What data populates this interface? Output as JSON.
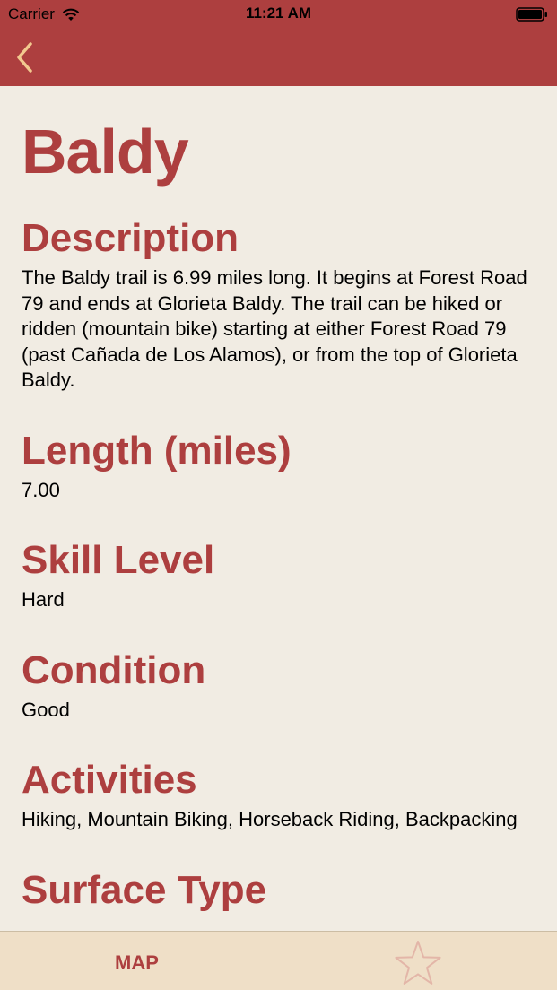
{
  "status_bar": {
    "carrier": "Carrier",
    "time": "11:21 AM"
  },
  "icons": {
    "back": "chevron-left-icon",
    "wifi": "wifi-icon",
    "battery": "battery-icon",
    "favorite": "star-outline-icon"
  },
  "colors": {
    "accent": "#ad3f3f",
    "back_chevron": "#f2c98f",
    "background": "#f1ece3",
    "tab_bar": "#efdfc7",
    "star_outline": "#e3b6a8"
  },
  "trail": {
    "name": "Baldy",
    "description_heading": "Description",
    "description": "The Baldy trail is 6.99 miles long. It begins at Forest Road 79 and ends at Glorieta Baldy. The trail can be hiked or ridden (mountain bike) starting at either Forest Road 79 (past Cañada de Los Alamos), or from the top of Glorieta Baldy.",
    "length_heading": "Length (miles)",
    "length": "7.00",
    "skill_heading": "Skill Level",
    "skill": "Hard",
    "condition_heading": "Condition",
    "condition": "Good",
    "activities_heading": "Activities",
    "activities": "Hiking, Mountain Biking, Horseback Riding, Backpacking",
    "surface_heading": "Surface Type"
  },
  "tab_bar": {
    "map_label": "MAP"
  }
}
